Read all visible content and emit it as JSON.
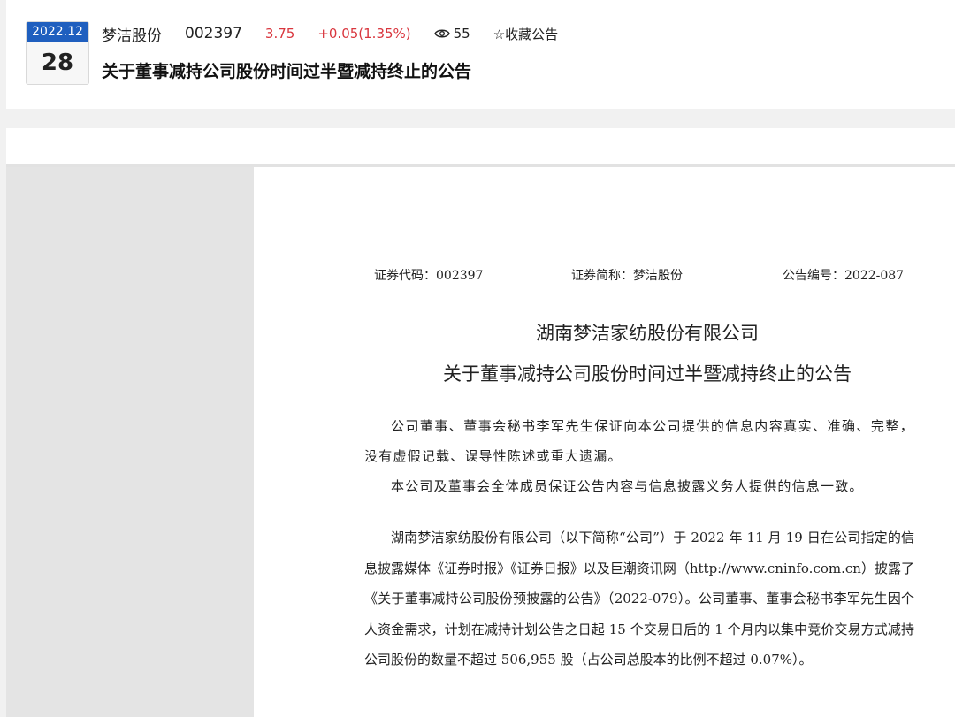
{
  "header": {
    "date_month": "2022.12",
    "date_day": "28",
    "stock_name": "梦洁股份",
    "stock_code": "002397",
    "price": "3.75",
    "change": "+0.05(1.35%)",
    "views": "55",
    "favorite_label": "☆收藏公告",
    "title": "关于董事减持公司股份时间过半暨减持终止的公告"
  },
  "document": {
    "code_label": "证券代码：002397",
    "abbr_label": "证券简称：梦洁股份",
    "number_label": "公告编号：2022-087",
    "company": "湖南梦洁家纺股份有限公司",
    "title": "关于董事减持公司股份时间过半暨减持终止的公告",
    "para1": "公司董事、董事会秘书李军先生保证向本公司提供的信息内容真实、准确、完整，没有虚假记载、误导性陈述或重大遗漏。",
    "para2": "本公司及董事会全体成员保证公告内容与信息披露义务人提供的信息一致。",
    "para3": "湖南梦洁家纺股份有限公司（以下简称“公司”）于 2022 年 11 月 19 日在公司指定的信息披露媒体《证券时报》《证券日报》以及巨潮资讯网（http://www.cninfo.com.cn）披露了《关于董事减持公司股份预披露的公告》（2022-079）。公司董事、董事会秘书李军先生因个人资金需求，计划在减持计划公告之日起 15 个交易日后的 1 个月内以集中竞价交易方式减持公司股份的数量不超过 506,955 股（占公司总股本的比例不超过 0.07%）。"
  },
  "colors": {
    "accent": "#1f5fbf",
    "price_red": "#d9363e"
  }
}
